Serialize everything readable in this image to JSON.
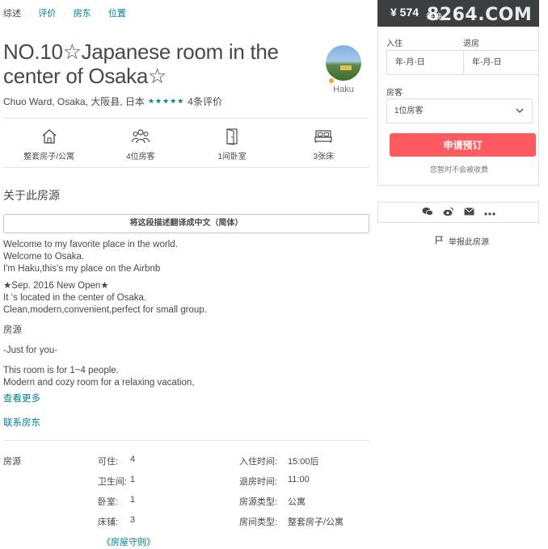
{
  "nav": {
    "items": [
      "综述",
      "评价",
      "房东",
      "位置"
    ],
    "separator": "·"
  },
  "listing": {
    "title": "NO.10☆Japanese room in the center of Osaka☆",
    "location": "Chuo Ward, Osaka, 大阪县, 日本",
    "stars": "★★★★★",
    "review_count": "4条评价",
    "host_name": "Haku"
  },
  "summary": [
    {
      "icon": "house-icon",
      "label": "整套房子/公寓"
    },
    {
      "icon": "guests-icon",
      "label": "4位房客"
    },
    {
      "icon": "door-icon",
      "label": "1间卧室"
    },
    {
      "icon": "bed-icon",
      "label": "3张床"
    }
  ],
  "about": {
    "title": "关于此房源",
    "translate_label": "将这段描述翻译成中文（简体）",
    "lines": [
      "Welcome to my favorite place in the world.",
      "Welcome to Osaka.",
      "I'm Haku,this's my place on the Airbnb",
      "",
      "★Sep. 2016 New Open★",
      "It ‘s located in the center of Osaka.",
      "Clean,modern,convenient,perfect for small group.",
      "",
      "房源",
      "",
      "-Just for you-",
      "",
      "This room is for 1~4 people.",
      "Modern and cozy room for a relaxing vacation,"
    ],
    "see_more": "查看更多",
    "contact_host": "联系房东"
  },
  "details": {
    "section_label": "房源",
    "left": [
      {
        "key": "可住:",
        "value": "4"
      },
      {
        "key": "卫生间:",
        "value": "1"
      },
      {
        "key": "卧室:",
        "value": "1"
      },
      {
        "key": "床铺:",
        "value": "3"
      }
    ],
    "right": [
      {
        "key": "入住时间:",
        "value": "15:00后"
      },
      {
        "key": "退房时间:",
        "value": "11:00"
      },
      {
        "key": "房源类型:",
        "value": "公寓"
      },
      {
        "key": "房间类型:",
        "value": "整套房子/公寓"
      }
    ],
    "rules_link": "《房屋守则》"
  },
  "booking": {
    "price": "¥ 574",
    "unit": "每晚",
    "watermark": "8264.COM",
    "checkin_label": "入住",
    "checkout_label": "退房",
    "checkin_placeholder": "年-月-日",
    "checkout_placeholder": "年-月-日",
    "guests_label": "房客",
    "guests_value": "1位房客",
    "book_label": "申请预订",
    "no_charge": "您暂时不会被收费"
  },
  "share": {
    "icons": [
      "wechat-icon",
      "weibo-icon",
      "mail-icon",
      "more-icon"
    ]
  },
  "report": {
    "label": "举报此房源"
  },
  "colors": {
    "accent": "#008489",
    "book_button": "#ff5a5f",
    "price_bar": "#3c3f40",
    "stars": "#008489",
    "host_badge": "#f4a623"
  }
}
